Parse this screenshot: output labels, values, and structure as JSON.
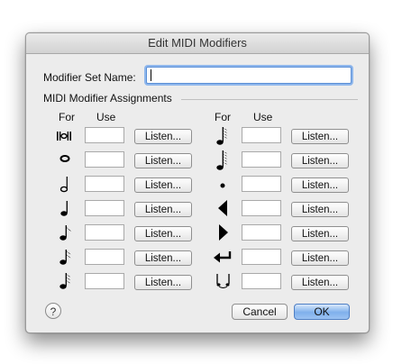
{
  "window": {
    "title": "Edit MIDI Modifiers"
  },
  "set_name": {
    "label": "Modifier Set Name:",
    "value": ""
  },
  "assignments": {
    "group_label": "MIDI Modifier Assignments",
    "for_header": "For",
    "use_header": "Use",
    "listen_label": "Listen...",
    "left_icons": [
      "breve-note-icon",
      "whole-note-icon",
      "half-note-icon",
      "quarter-note-icon",
      "eighth-note-icon",
      "sixteenth-note-icon",
      "thirty-second-note-icon"
    ],
    "right_icons": [
      "sixty-fourth-note-icon",
      "one-twenty-eighth-note-icon",
      "dot-icon",
      "left-triangle-icon",
      "right-triangle-icon",
      "return-arrow-icon",
      "tie-icon"
    ]
  },
  "buttons": {
    "help": "?",
    "cancel": "Cancel",
    "ok": "OK"
  }
}
